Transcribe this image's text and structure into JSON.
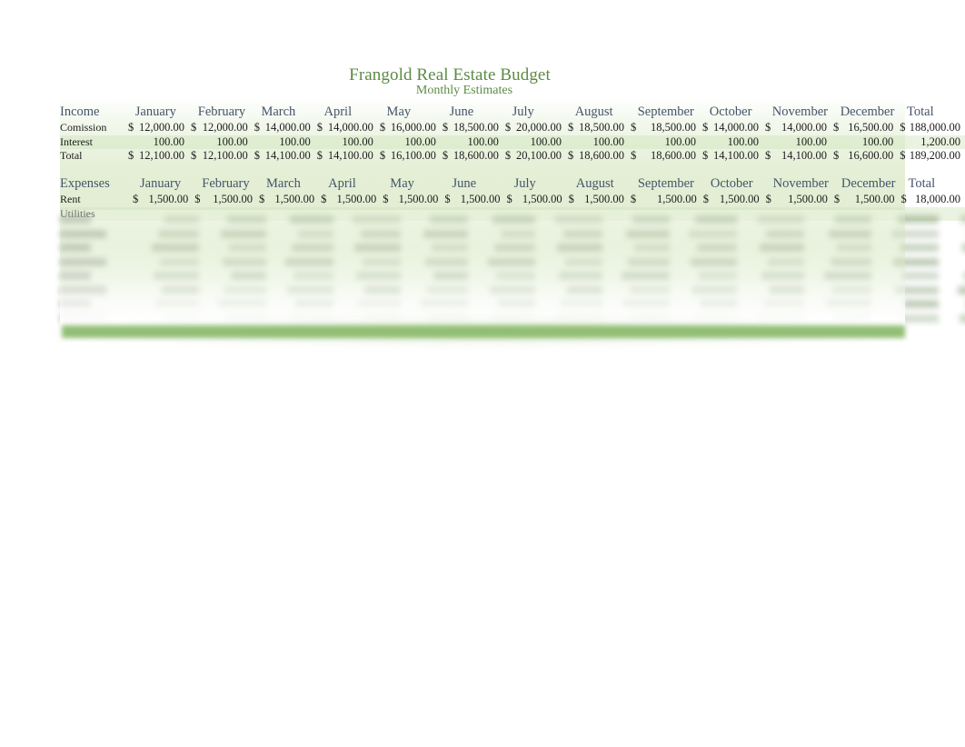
{
  "document": {
    "title": "Frangold Real Estate Budget",
    "subtitle": "Monthly Estimates"
  },
  "colors": {
    "title_green": "#5c8a44",
    "header_slate": "#44546a",
    "band_green": "#cee2b8",
    "bar_green": "#8dbb6e",
    "text": "#1c1c1c"
  },
  "months": [
    "January",
    "February",
    "March",
    "April",
    "May",
    "June",
    "July",
    "August",
    "September",
    "October",
    "November",
    "December"
  ],
  "total_header": "Total",
  "currency_symbol": "$",
  "income": {
    "section_label": "Income",
    "rows": [
      {
        "label": "Comission",
        "show_currency": true,
        "values": [
          "12,000.00",
          "12,000.00",
          "14,000.00",
          "14,000.00",
          "16,000.00",
          "18,500.00",
          "20,000.00",
          "18,500.00",
          "18,500.00",
          "14,000.00",
          "14,000.00",
          "16,500.00"
        ],
        "total": "188,000.00"
      },
      {
        "label": "Interest",
        "show_currency": false,
        "values": [
          "100.00",
          "100.00",
          "100.00",
          "100.00",
          "100.00",
          "100.00",
          "100.00",
          "100.00",
          "100.00",
          "100.00",
          "100.00",
          "100.00"
        ],
        "total": "1,200.00"
      },
      {
        "label": "Total",
        "show_currency": true,
        "values": [
          "12,100.00",
          "12,100.00",
          "14,100.00",
          "14,100.00",
          "16,100.00",
          "18,600.00",
          "20,100.00",
          "18,600.00",
          "18,600.00",
          "14,100.00",
          "14,100.00",
          "16,600.00"
        ],
        "total": "189,200.00"
      }
    ]
  },
  "expenses": {
    "section_label": "Expenses",
    "rows": [
      {
        "label": "Rent",
        "show_currency": true,
        "values": [
          "1,500.00",
          "1,500.00",
          "1,500.00",
          "1,500.00",
          "1,500.00",
          "1,500.00",
          "1,500.00",
          "1,500.00",
          "1,500.00",
          "1,500.00",
          "1,500.00",
          "1,500.00"
        ],
        "total": "18,000.00"
      },
      {
        "label": "Utilities",
        "show_currency": false,
        "values": [
          "",
          "",
          "",
          "",
          "",
          "",
          "",
          "",
          "",
          "",
          "",
          ""
        ],
        "total": ""
      }
    ]
  },
  "obscured_region": {
    "note": "Remaining expense rows and totals are blurred / faded out and not legible.",
    "ghost_row_count": 8
  }
}
